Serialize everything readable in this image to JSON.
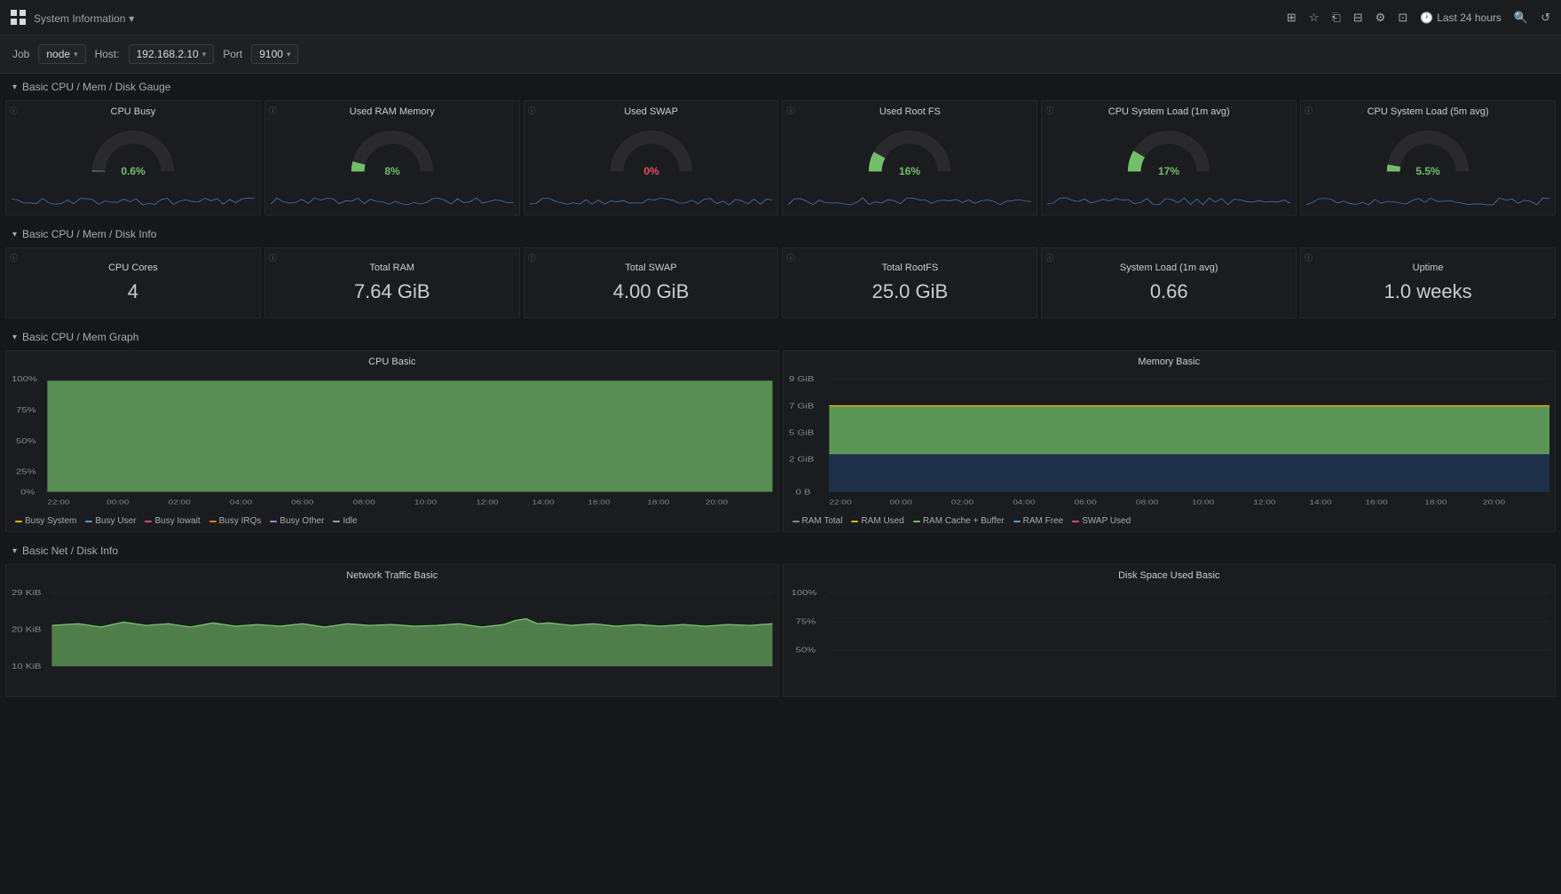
{
  "app": {
    "title": "System Information",
    "title_arrow": "▾"
  },
  "header_icons": [
    "chart-add-icon",
    "star-icon",
    "share-icon",
    "library-icon",
    "gear-icon",
    "monitor-icon"
  ],
  "time_range": {
    "label": "Last 24 hours",
    "icon": "clock-icon"
  },
  "search_icon": "search-icon",
  "refresh_icon": "refresh-icon",
  "filters": {
    "job_label": "Job",
    "job_value": "node",
    "host_label": "Host:",
    "host_value": "192.168.2.10",
    "port_label": "Port",
    "port_value": "9100"
  },
  "sections": {
    "gauge_section": {
      "label": "Basic CPU / Mem / Disk Gauge",
      "collapsed": false
    },
    "info_section": {
      "label": "Basic CPU / Mem / Disk Info",
      "collapsed": false
    },
    "graph_section": {
      "label": "Basic CPU / Mem Graph",
      "collapsed": false
    },
    "netdisk_section": {
      "label": "Basic Net / Disk Info",
      "collapsed": false
    }
  },
  "gauges": [
    {
      "title": "CPU Busy",
      "value": "0.6%",
      "color": "green",
      "percent": 0.6
    },
    {
      "title": "Used RAM Memory",
      "value": "8%",
      "color": "green",
      "percent": 8
    },
    {
      "title": "Used SWAP",
      "value": "0%",
      "color": "red",
      "percent": 0
    },
    {
      "title": "Used Root FS",
      "value": "16%",
      "color": "green",
      "percent": 16
    },
    {
      "title": "CPU System Load (1m avg)",
      "value": "17%",
      "color": "green",
      "percent": 17
    },
    {
      "title": "CPU System Load (5m avg)",
      "value": "5.5%",
      "color": "green",
      "percent": 5.5
    }
  ],
  "info_cards": [
    {
      "title": "CPU Cores",
      "value": "4"
    },
    {
      "title": "Total RAM",
      "value": "7.64 GiB"
    },
    {
      "title": "Total SWAP",
      "value": "4.00 GiB"
    },
    {
      "title": "Total RootFS",
      "value": "25.0 GiB"
    },
    {
      "title": "System Load (1m avg)",
      "value": "0.66"
    },
    {
      "title": "Uptime",
      "value": "1.0 weeks"
    }
  ],
  "cpu_graph": {
    "title": "CPU Basic",
    "y_labels": [
      "100%",
      "75%",
      "50%",
      "25%",
      "0%"
    ],
    "x_labels": [
      "22:00",
      "00:00",
      "02:00",
      "04:00",
      "06:00",
      "08:00",
      "10:00",
      "12:00",
      "14:00",
      "16:00",
      "18:00",
      "20:00"
    ],
    "legend": [
      {
        "label": "Busy System",
        "color": "#E0B400"
      },
      {
        "label": "Busy User",
        "color": "#5794F2"
      },
      {
        "label": "Busy Iowait",
        "color": "#F2495C"
      },
      {
        "label": "Busy IRQs",
        "color": "#FF780A"
      },
      {
        "label": "Busy Other",
        "color": "#B877D9"
      },
      {
        "label": "Idle",
        "color": "#73BF69"
      }
    ]
  },
  "memory_graph": {
    "title": "Memory Basic",
    "y_labels": [
      "9 GiB",
      "7 GiB",
      "5 GiB",
      "2 GiB",
      "0 B"
    ],
    "x_labels": [
      "22:00",
      "00:00",
      "02:00",
      "04:00",
      "06:00",
      "08:00",
      "10:00",
      "12:00",
      "14:00",
      "16:00",
      "18:00",
      "20:00"
    ],
    "legend": [
      {
        "label": "RAM Total",
        "color": "#333"
      },
      {
        "label": "RAM Used",
        "color": "#E0B400"
      },
      {
        "label": "RAM Cache + Buffer",
        "color": "#73BF69"
      },
      {
        "label": "RAM Free",
        "color": "#5794F2"
      },
      {
        "label": "SWAP Used",
        "color": "#F2495C"
      }
    ]
  },
  "net_graph": {
    "title": "Network Traffic Basic",
    "y_labels": [
      "29 KiB",
      "20 KiB",
      "10 KiB"
    ]
  },
  "disk_graph": {
    "title": "Disk Space Used Basic",
    "y_labels": [
      "100%",
      "75%",
      "50%"
    ]
  }
}
